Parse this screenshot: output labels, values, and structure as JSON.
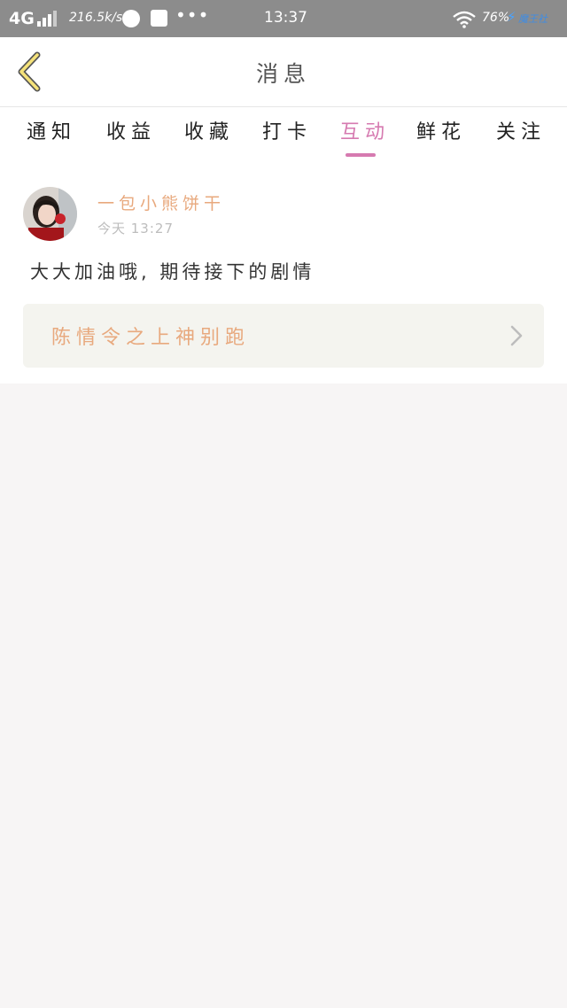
{
  "status_bar": {
    "network": "4G",
    "speed": "216.5k/s",
    "dots": "•••",
    "time": "13:37",
    "battery": "76%",
    "brand": "魔王社"
  },
  "header": {
    "title": "消息"
  },
  "tabs": [
    {
      "label": "通知"
    },
    {
      "label": "收益"
    },
    {
      "label": "收藏"
    },
    {
      "label": "打卡"
    },
    {
      "label": "互动"
    },
    {
      "label": "鲜花"
    },
    {
      "label": "关注"
    }
  ],
  "active_tab_index": 4,
  "message": {
    "username": "一包小熊饼干",
    "timestamp": "今天 13:27",
    "text": "大大加油哦, 期待接下的剧情",
    "work_title": "陈情令之上神别跑"
  },
  "colors": {
    "accent_pink": "#d67ab0",
    "name_orange": "#e8a97e",
    "status_bar": "#8c8c8c"
  },
  "icons": {
    "back": "chevron-left-icon",
    "go": "chevron-right-icon"
  }
}
